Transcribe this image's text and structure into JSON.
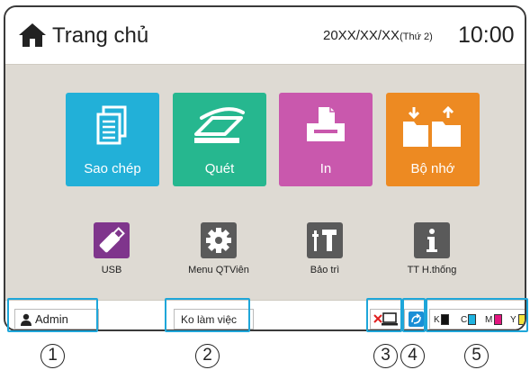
{
  "header": {
    "title": "Trang chủ",
    "date": "20XX/XX/XX",
    "weekday": "(Thứ 2)",
    "time": "10:00"
  },
  "main_tiles": [
    {
      "label": "Sao chép",
      "icon": "copy-icon",
      "color": "#22b0d8"
    },
    {
      "label": "Quét",
      "icon": "scan-icon",
      "color": "#26b78f"
    },
    {
      "label": "In",
      "icon": "print-icon",
      "color": "#c958ad"
    },
    {
      "label": "Bộ nhớ",
      "icon": "storage-icon",
      "color": "#ed8a22"
    }
  ],
  "small_tiles": [
    {
      "label": "USB",
      "icon": "usb-icon",
      "color": "#7f358c"
    },
    {
      "label": "Menu QTViên",
      "icon": "gear-icon",
      "color": "#5a5a5a"
    },
    {
      "label": "Bảo trì",
      "icon": "maintenance-icon",
      "color": "#5a5a5a"
    },
    {
      "label": "TT H.thống",
      "icon": "info-icon",
      "color": "#5a5a5a"
    }
  ],
  "statusbar": {
    "user": "Admin",
    "status": "Ko làm việc",
    "ink": [
      {
        "label": "K",
        "color": "#111111"
      },
      {
        "label": "C",
        "color": "#1fb3e0"
      },
      {
        "label": "M",
        "color": "#e3167f"
      },
      {
        "label": "Y",
        "color": "#f3e43a"
      }
    ]
  },
  "callouts": [
    "1",
    "2",
    "3",
    "4",
    "5"
  ],
  "accent_color": "#1fa6d9"
}
